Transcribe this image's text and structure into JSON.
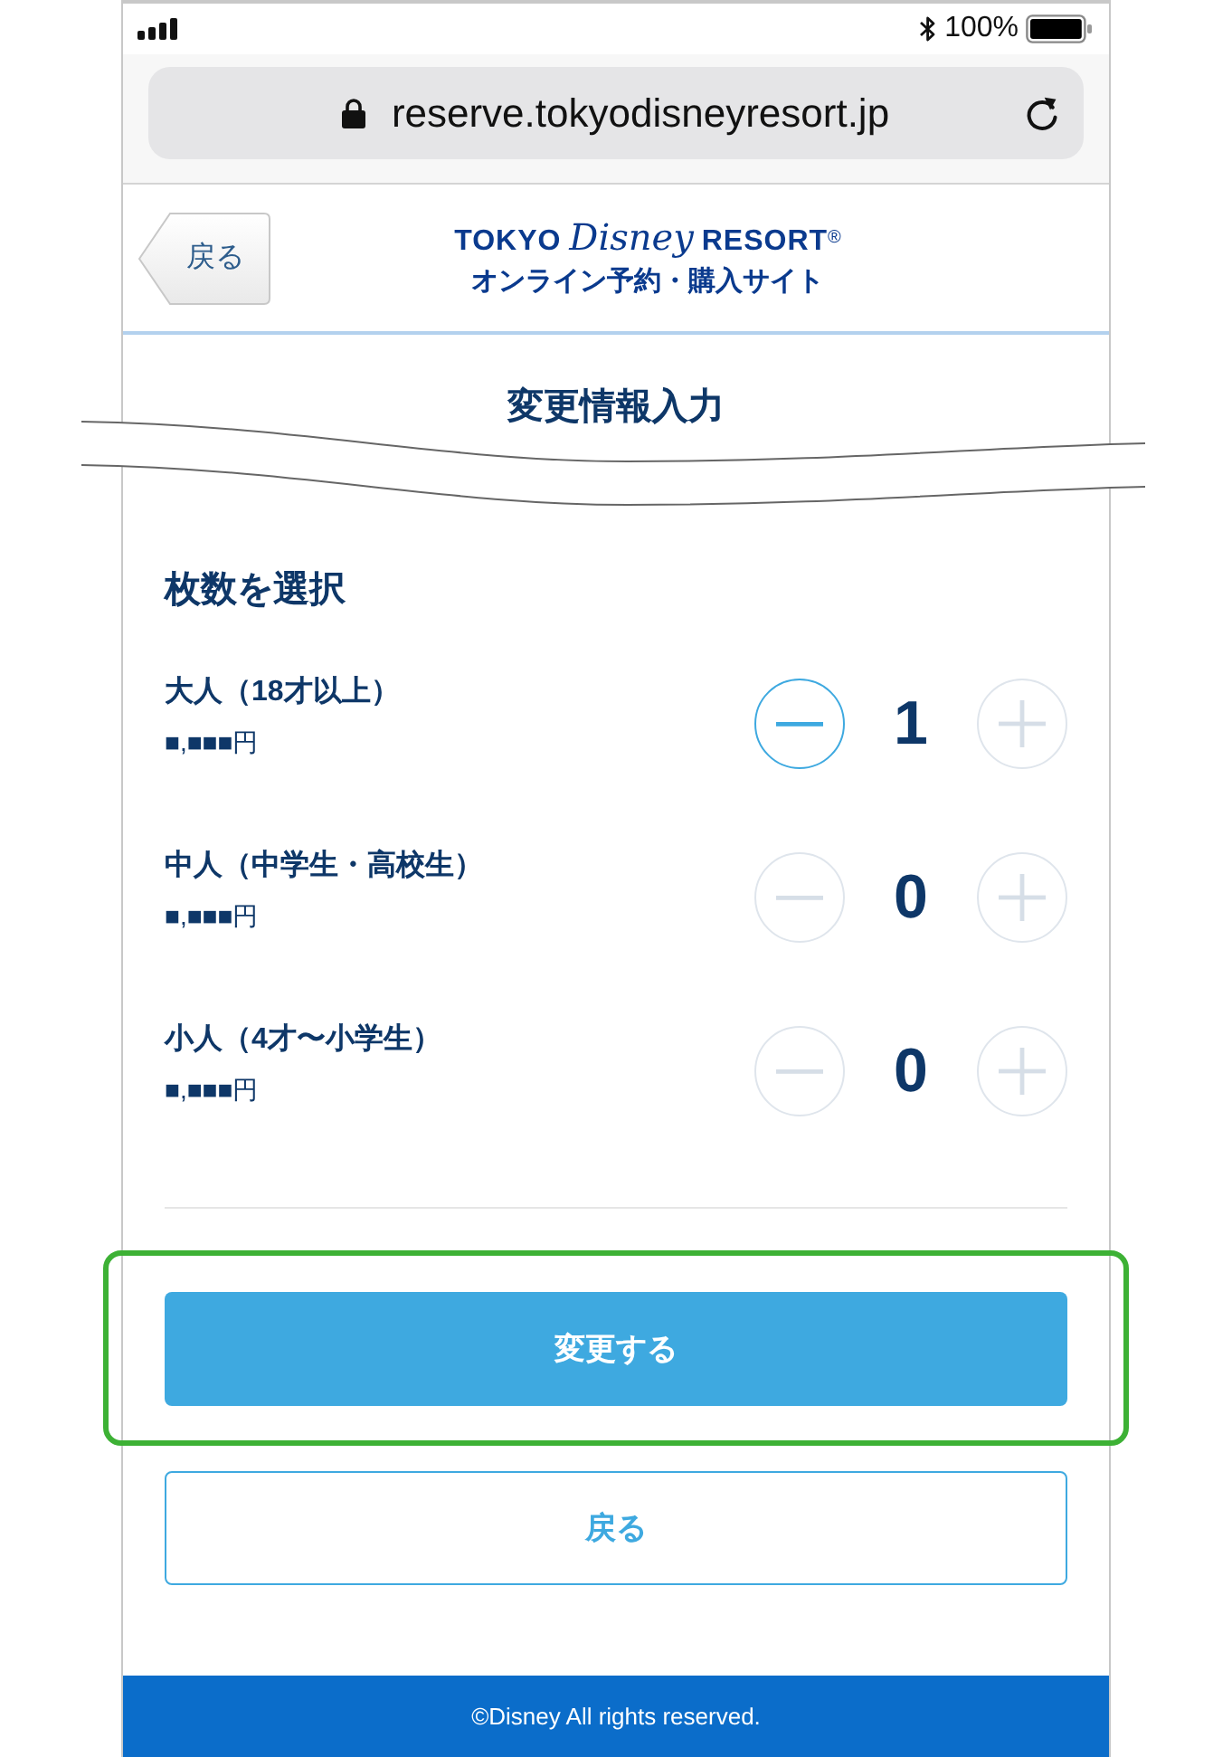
{
  "status_bar": {
    "battery_text": "100%"
  },
  "address_bar": {
    "url": "reserve.tokyodisneyresort.jp"
  },
  "header": {
    "back_button": "戻る",
    "logo": {
      "words": [
        "TOKYO",
        "Disney",
        "RESORT"
      ],
      "mark": "®",
      "subtitle": "オンライン予約・購入サイト"
    }
  },
  "page_title": "変更情報入力",
  "section_title": "枚数を選択",
  "ticket_types": [
    {
      "label": "大人（18才以上）",
      "price": "■,■■■円",
      "count": "1",
      "minus_disabled": false,
      "plus_disabled": true
    },
    {
      "label": "中人（中学生・高校生）",
      "price": "■,■■■円",
      "count": "0",
      "minus_disabled": true,
      "plus_disabled": true
    },
    {
      "label": "小人（4才〜小学生）",
      "price": "■,■■■円",
      "count": "0",
      "minus_disabled": true,
      "plus_disabled": true
    }
  ],
  "primary_button": {
    "label": "変更する",
    "highlighted": true
  },
  "secondary_button": {
    "label": "戻る"
  },
  "footer": {
    "copyright": "©Disney All rights reserved."
  }
}
